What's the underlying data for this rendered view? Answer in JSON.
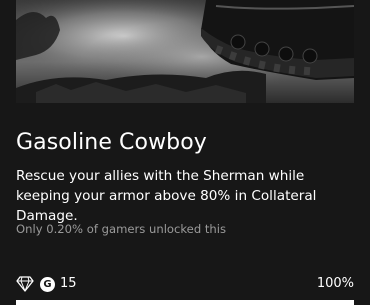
{
  "achievement": {
    "title": "Gasoline Cowboy",
    "description": "Rescue your allies with the Sherman while keeping your armor above 80% in Collateral Damage.",
    "rarity_text": "Only 0.20% of gamers unlocked this",
    "gamerscore_badge": "G",
    "gamerscore": "15",
    "progress_text": "100%",
    "progress_fraction": 1.0,
    "rarity_icon": "diamond-icon",
    "hero_image": "battlefield-tank-artwork"
  },
  "colors": {
    "background": "#171717",
    "text": "#ffffff",
    "muted": "#9a9a9a",
    "progress_track": "#3a3a3a",
    "progress_fill": "#ffffff"
  }
}
